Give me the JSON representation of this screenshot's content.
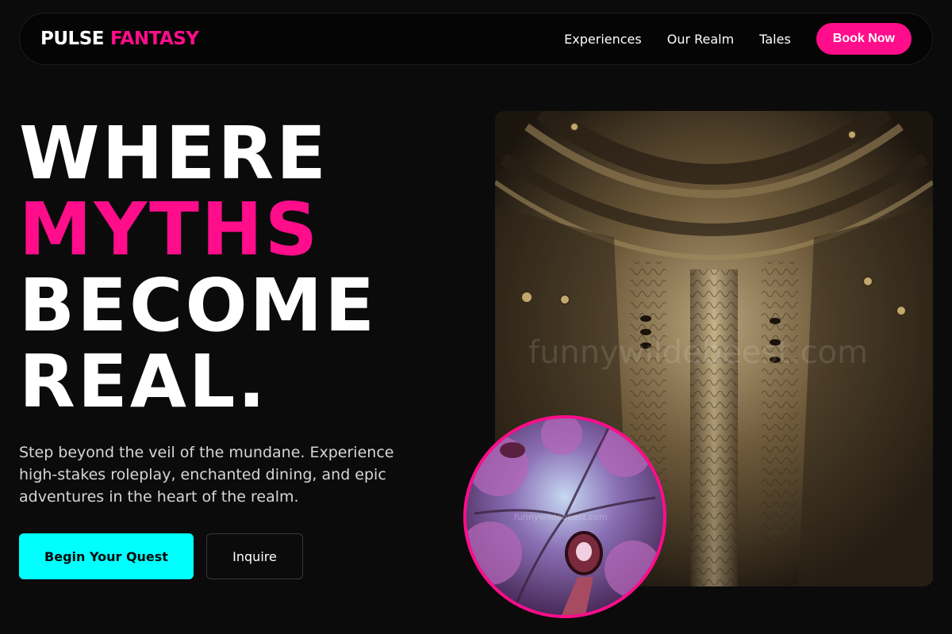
{
  "nav": {
    "logo_word1": "PULSE",
    "logo_word2": "FANTASY",
    "links": [
      "Experiences",
      "Our Realm",
      "Tales"
    ],
    "cta": "Book Now"
  },
  "hero": {
    "title_lines": [
      "WHERE",
      "MYTHS",
      "BECOME",
      "REAL."
    ],
    "description": "Step beyond the veil of the mundane. Experience high-stakes roleplay, enchanted dining, and epic adventures in the heart of the realm.",
    "primary_button": "Begin Your Quest",
    "secondary_button": "Inquire"
  },
  "images": {
    "armor_watermark": "funnywildebeest.com",
    "forest_watermark": "funnywildebeest.com"
  },
  "colors": {
    "background": "#0b0b0c",
    "accent_pink": "#ff0d8a",
    "accent_cyan": "#00ffff"
  }
}
